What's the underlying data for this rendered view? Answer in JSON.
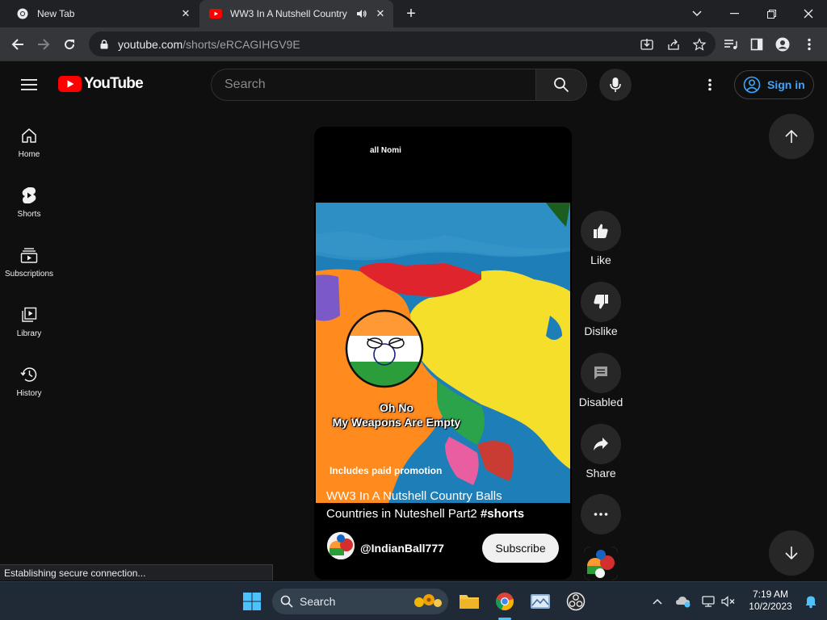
{
  "browser": {
    "tabs": [
      {
        "title": "New Tab",
        "favicon": "chrome-icon",
        "active": false
      },
      {
        "title": "WW3 In A Nutshell Country",
        "favicon": "youtube-icon",
        "active": true,
        "audio": true
      }
    ],
    "url": {
      "host": "youtube.com",
      "path": "/shorts/eRCAGIHGV9E"
    },
    "status": "Establishing secure connection..."
  },
  "youtube": {
    "logo_text": "YouTube",
    "search_placeholder": "Search",
    "signin_label": "Sign in",
    "sidebar": [
      {
        "label": "Home",
        "icon": "home-icon"
      },
      {
        "label": "Shorts",
        "icon": "shorts-icon"
      },
      {
        "label": "Subscriptions",
        "icon": "subscriptions-icon"
      },
      {
        "label": "Library",
        "icon": "library-icon"
      },
      {
        "label": "History",
        "icon": "history-icon"
      }
    ],
    "short": {
      "overlay_top": "all Nomi",
      "caption_line1": "Oh No",
      "caption_line2": "My Weapons Are Empty",
      "paid_promotion": "Includes paid promotion",
      "title_line1": "WW3 In A Nutshell Country Balls",
      "title_line2": "Countries in Nuteshell Part2",
      "hashtag": "#shorts",
      "channel": "@IndianBall777",
      "subscribe_label": "Subscribe"
    },
    "actions": [
      {
        "label": "Like",
        "icon": "thumbs-up-icon"
      },
      {
        "label": "Dislike",
        "icon": "thumbs-down-icon"
      },
      {
        "label": "Disabled",
        "icon": "comments-icon"
      },
      {
        "label": "Share",
        "icon": "share-icon"
      },
      {
        "label": "",
        "icon": "more-icon"
      }
    ]
  },
  "taskbar": {
    "search_label": "Search",
    "time": "7:19 AM",
    "date": "10/2/2023"
  },
  "colors": {
    "yt_red": "#ff0000",
    "link_blue": "#3ea6ff",
    "bg": "#0f0f0f"
  }
}
